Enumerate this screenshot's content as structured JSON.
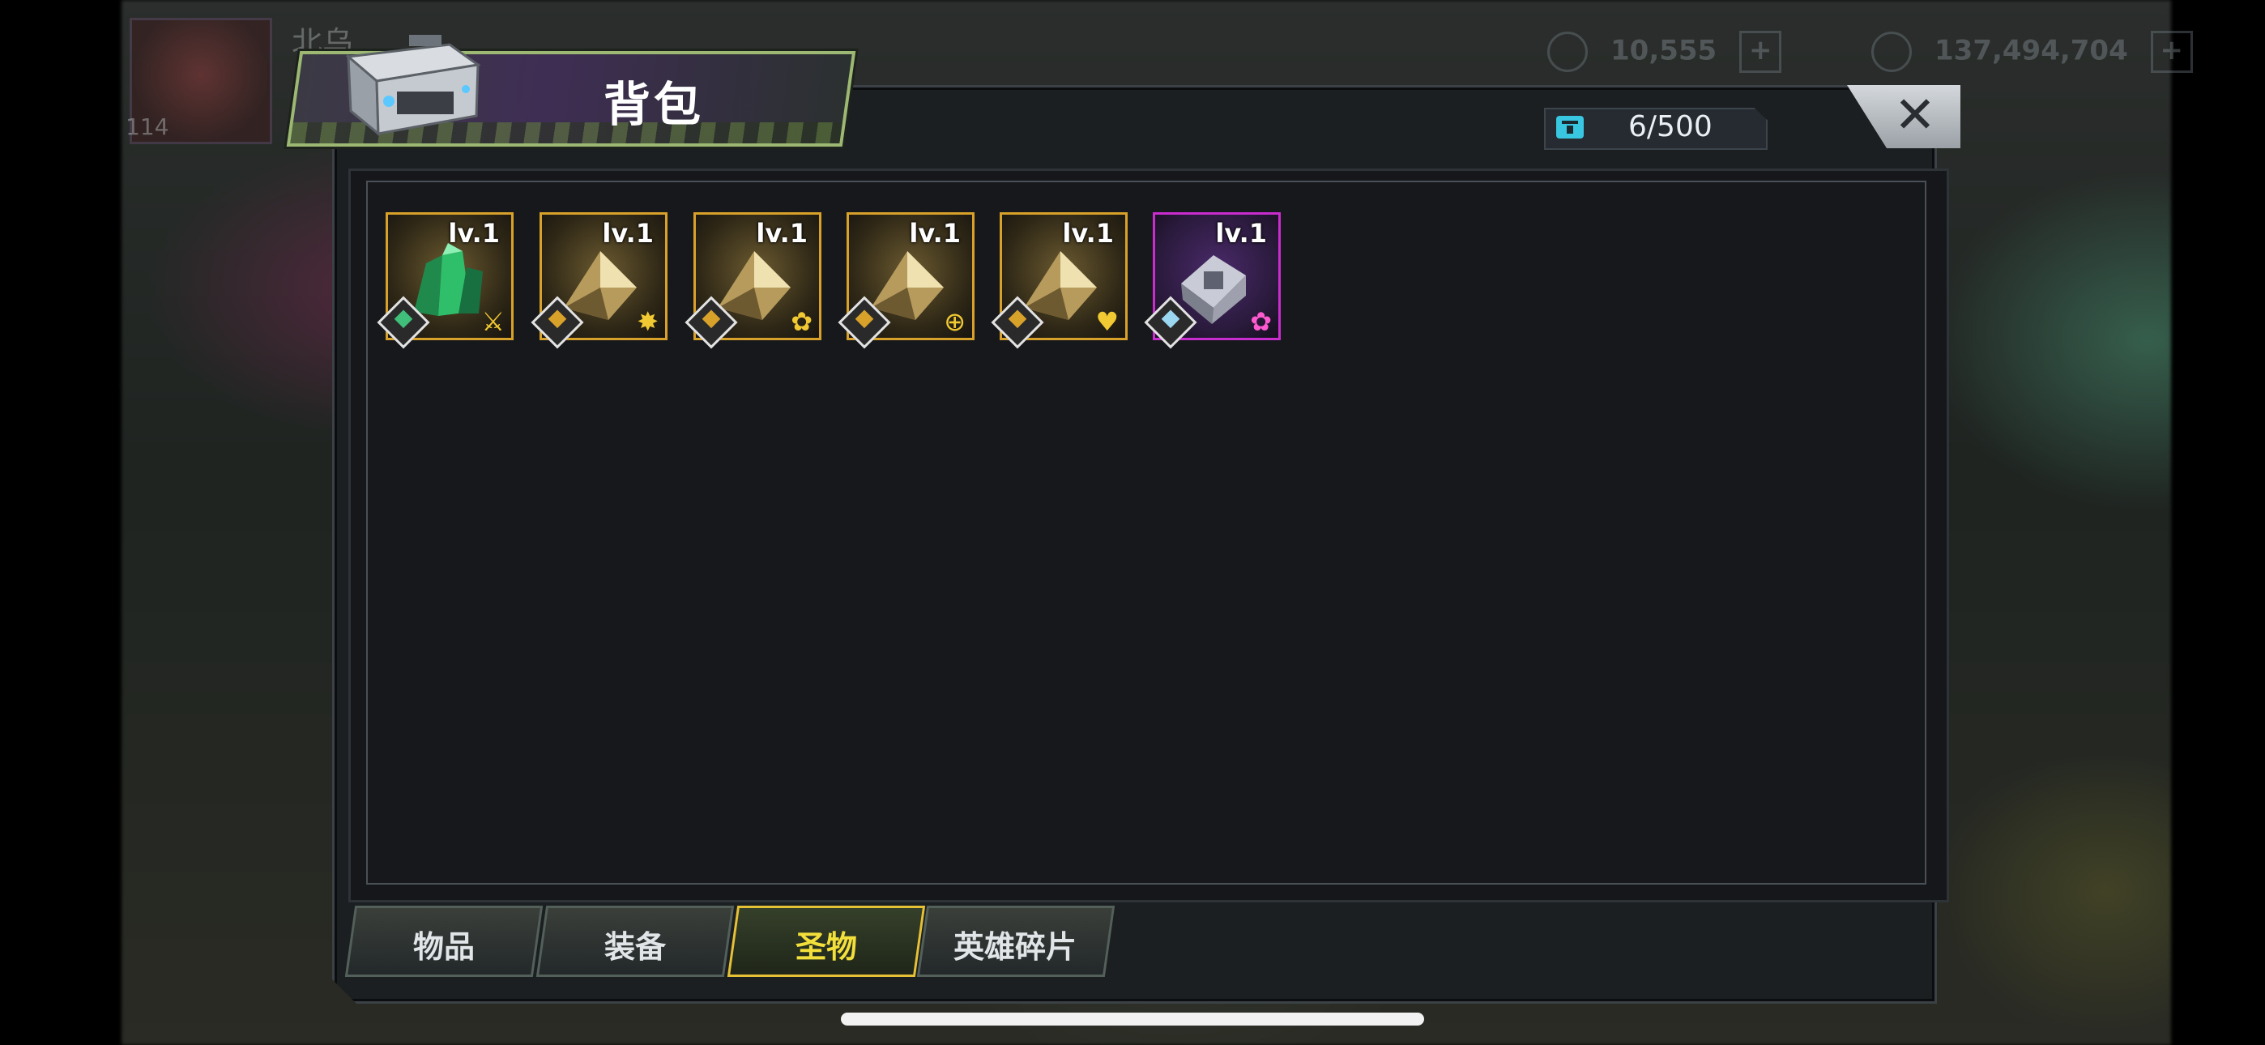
{
  "backdrop": {
    "player_level": "114",
    "player_name": "北乌",
    "resource_1": "10,555",
    "resource_2": "137,494,704"
  },
  "window": {
    "title": "背包",
    "capacity": "6/500",
    "close_label": "✕"
  },
  "items": [
    {
      "level": "lv.1",
      "rarity": "orange",
      "kind": "green-crystal",
      "corner_icon": "sword"
    },
    {
      "level": "lv.1",
      "rarity": "orange",
      "kind": "gold-relic",
      "corner_icon": "sparkle"
    },
    {
      "level": "lv.1",
      "rarity": "orange",
      "kind": "gold-relic",
      "corner_icon": "cluster"
    },
    {
      "level": "lv.1",
      "rarity": "orange",
      "kind": "gold-relic",
      "corner_icon": "crosshair"
    },
    {
      "level": "lv.1",
      "rarity": "orange",
      "kind": "gold-relic",
      "corner_icon": "heart"
    },
    {
      "level": "lv.1",
      "rarity": "purple",
      "kind": "silver-cube",
      "corner_icon": "cluster"
    }
  ],
  "tabs": [
    {
      "label": "物品",
      "active": false
    },
    {
      "label": "装备",
      "active": false
    },
    {
      "label": "圣物",
      "active": true
    },
    {
      "label": "英雄碎片",
      "active": false
    }
  ],
  "colors": {
    "orange_frame": "#d8a12a",
    "purple_frame": "#c92ccf",
    "active_tab": "#e6c136",
    "banner_border": "#9cb873"
  }
}
